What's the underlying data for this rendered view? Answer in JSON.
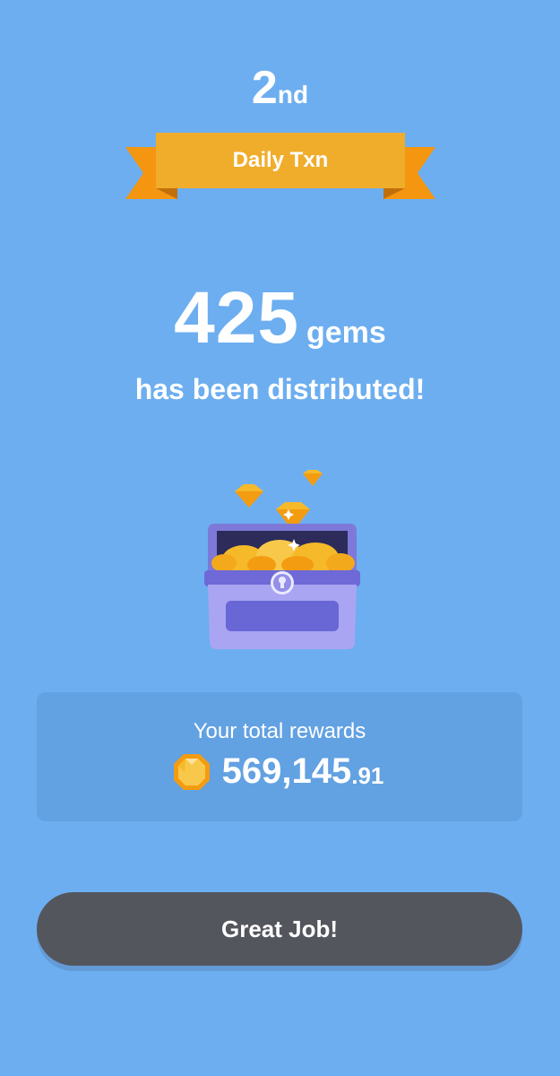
{
  "rank": {
    "number": "2",
    "suffix": "nd"
  },
  "ribbon": {
    "label": "Daily Txn"
  },
  "distribution": {
    "amount": "425",
    "unit": "gems",
    "message": "has been distributed!"
  },
  "illustration": {
    "icon": "treasure-chest-with-gems-icon"
  },
  "rewards": {
    "label": "Your total rewards",
    "icon": "gem-coin-icon",
    "value_integer": "569,145",
    "value_decimal": ".91"
  },
  "action": {
    "button_label": "Great Job!"
  },
  "colors": {
    "background": "#6daef0",
    "card": "#62a1e2",
    "ribbon": "#f0ad2c",
    "ribbon_tail": "#f4960f",
    "button": "#54565d",
    "chest": "#9b97ec",
    "gold": "#f6b929"
  }
}
